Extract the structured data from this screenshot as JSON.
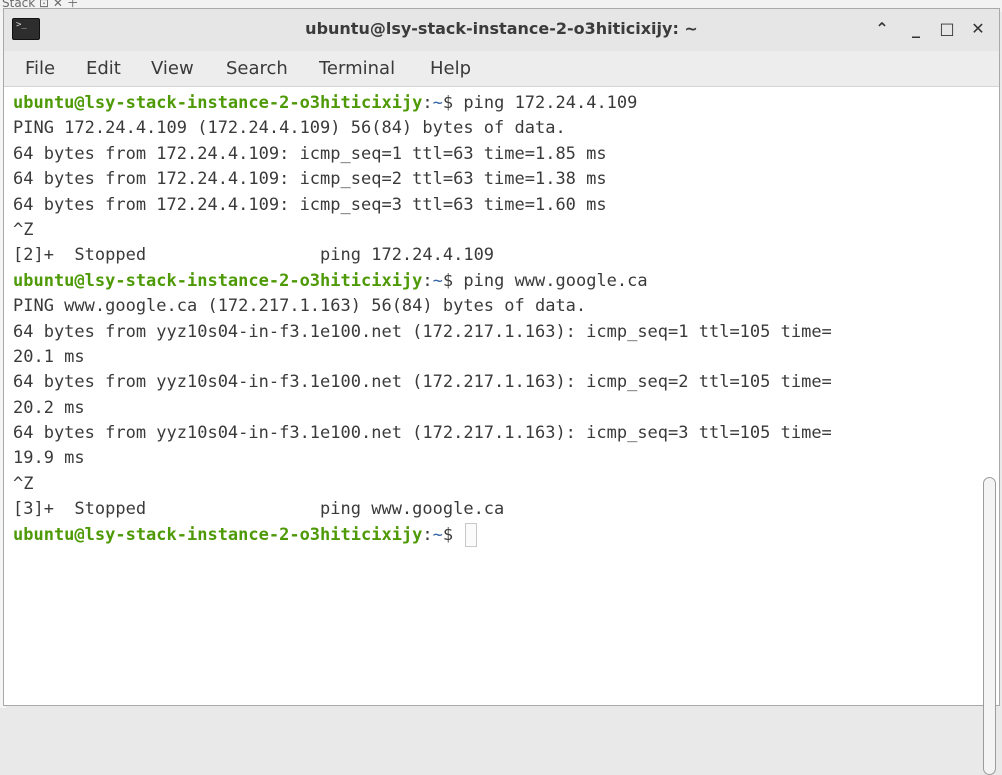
{
  "background_window": {
    "title_fragment": "Stack ⊡ ✕ ＋"
  },
  "window": {
    "title": "ubuntu@lsy-stack-instance-2-o3hiticixijy: ~",
    "icon": "terminal-icon",
    "controls": {
      "up": "⌃",
      "minimize": "_",
      "maximize": "□",
      "close": "✕"
    }
  },
  "menubar": {
    "items": [
      "File",
      "Edit",
      "View",
      "Search",
      "Terminal",
      "Help"
    ]
  },
  "colors": {
    "prompt_user": "#4e9a06",
    "prompt_path": "#3465a4",
    "text": "#3a3a3a"
  },
  "terminal": {
    "lines": [
      {
        "type": "prompt",
        "user": "ubuntu@lsy-stack-instance-2-o3hiticixijy",
        "sep": ":",
        "path": "~",
        "symbol": "$ ",
        "cmd": "ping 172.24.4.109"
      },
      {
        "type": "output",
        "text": "PING 172.24.4.109 (172.24.4.109) 56(84) bytes of data."
      },
      {
        "type": "output",
        "text": "64 bytes from 172.24.4.109: icmp_seq=1 ttl=63 time=1.85 ms"
      },
      {
        "type": "output",
        "text": "64 bytes from 172.24.4.109: icmp_seq=2 ttl=63 time=1.38 ms"
      },
      {
        "type": "output",
        "text": "64 bytes from 172.24.4.109: icmp_seq=3 ttl=63 time=1.60 ms"
      },
      {
        "type": "output",
        "text": "^Z"
      },
      {
        "type": "output",
        "text": "[2]+  Stopped                 ping 172.24.4.109"
      },
      {
        "type": "prompt",
        "user": "ubuntu@lsy-stack-instance-2-o3hiticixijy",
        "sep": ":",
        "path": "~",
        "symbol": "$ ",
        "cmd": "ping www.google.ca"
      },
      {
        "type": "output",
        "text": "PING www.google.ca (172.217.1.163) 56(84) bytes of data."
      },
      {
        "type": "output",
        "text": "64 bytes from yyz10s04-in-f3.1e100.net (172.217.1.163): icmp_seq=1 ttl=105 time="
      },
      {
        "type": "output",
        "text": "20.1 ms"
      },
      {
        "type": "output",
        "text": "64 bytes from yyz10s04-in-f3.1e100.net (172.217.1.163): icmp_seq=2 ttl=105 time="
      },
      {
        "type": "output",
        "text": "20.2 ms"
      },
      {
        "type": "output",
        "text": "64 bytes from yyz10s04-in-f3.1e100.net (172.217.1.163): icmp_seq=3 ttl=105 time="
      },
      {
        "type": "output",
        "text": "19.9 ms"
      },
      {
        "type": "output",
        "text": "^Z"
      },
      {
        "type": "output",
        "text": "[3]+  Stopped                 ping www.google.ca"
      },
      {
        "type": "prompt",
        "user": "ubuntu@lsy-stack-instance-2-o3hiticixijy",
        "sep": ":",
        "path": "~",
        "symbol": "$ ",
        "cmd": "",
        "cursor": true
      }
    ]
  }
}
